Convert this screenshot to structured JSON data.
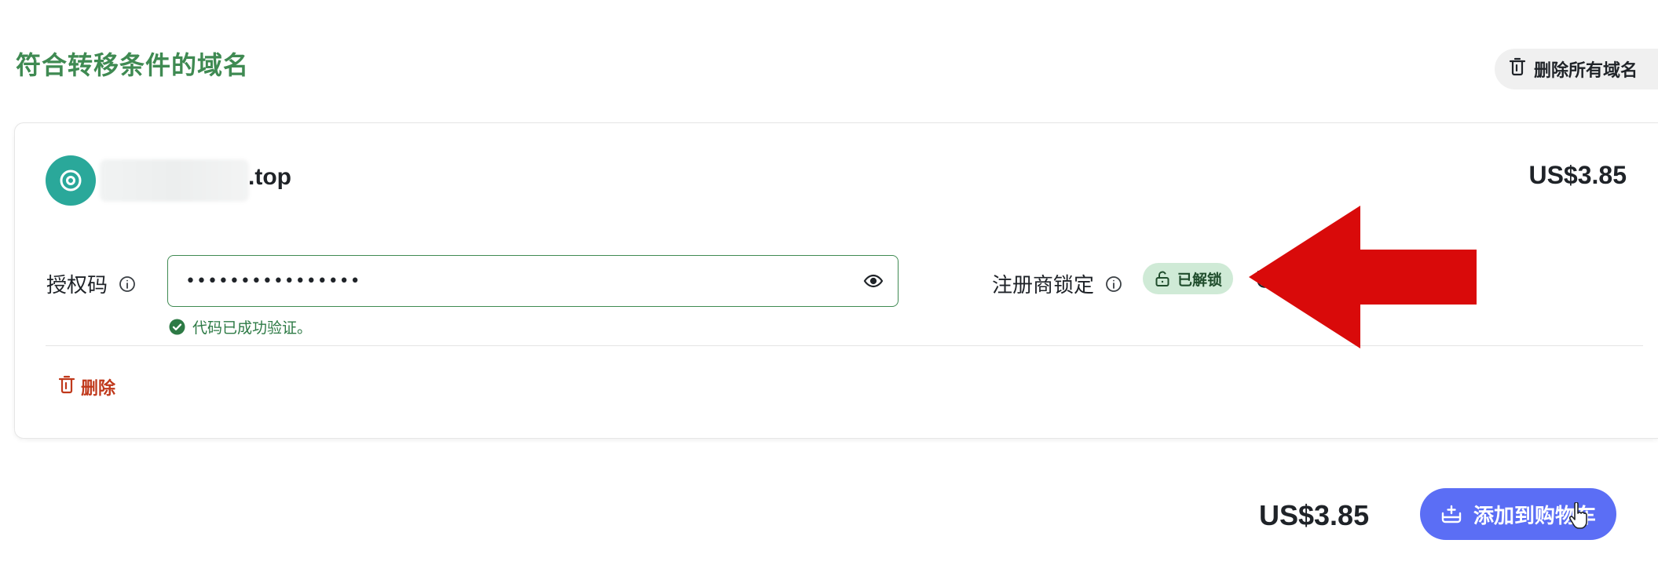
{
  "section": {
    "title": "符合转移条件的域名"
  },
  "toolbar": {
    "remove_all_label": "删除所有域名"
  },
  "domain": {
    "tld": ".top",
    "price": "US$3.85"
  },
  "auth": {
    "label": "授权码",
    "value": "••••••••••••••••",
    "verify_message": "代码已成功验证。"
  },
  "lock": {
    "label": "注册商锁定",
    "status": "已解锁"
  },
  "actions": {
    "delete_label": "删除"
  },
  "footer": {
    "total_price": "US$3.85",
    "add_to_cart_label": "添加到购物车"
  },
  "colors": {
    "title_green": "#3f8a52",
    "icon_teal": "#2aa89a",
    "badge_green": "#cfead6",
    "delete_red": "#c0391b",
    "button_blue": "#5b6ef5",
    "annotation_red": "#d90a0a"
  }
}
